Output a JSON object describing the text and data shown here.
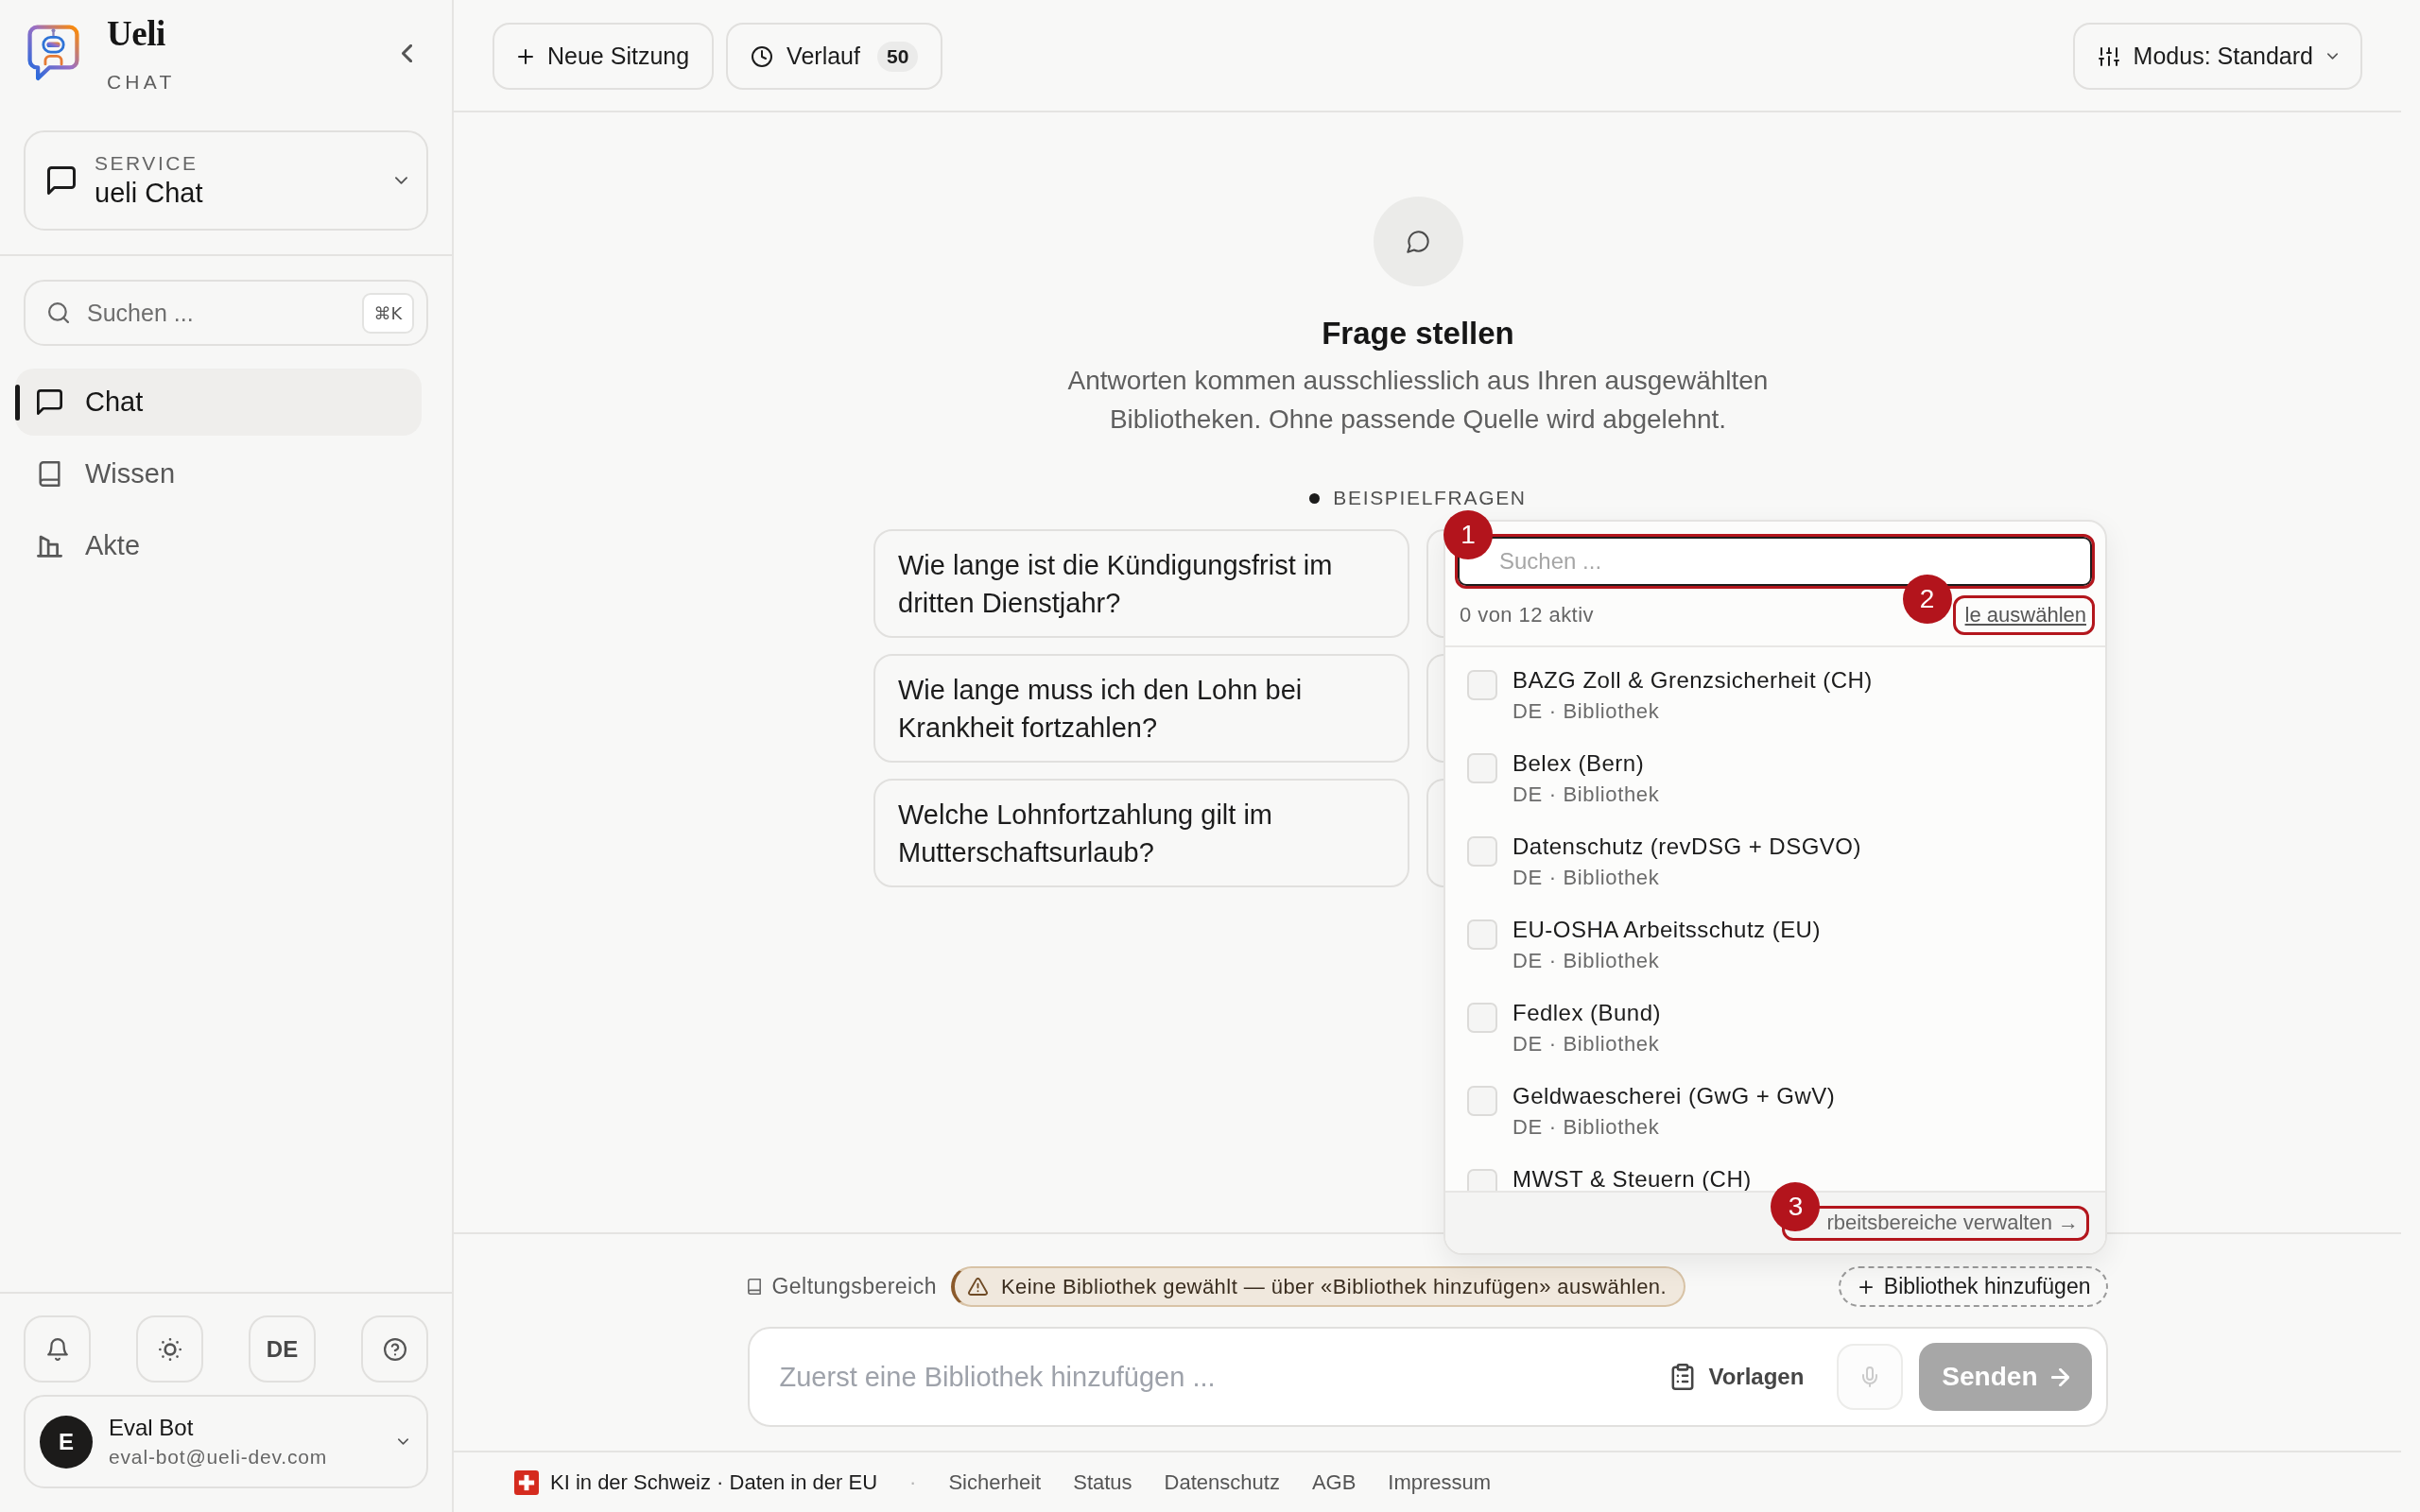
{
  "sidebar": {
    "brand": {
      "name": "Ueli",
      "tagline": "CHAT"
    },
    "service": {
      "label": "SERVICE",
      "value": "ueli Chat"
    },
    "search": {
      "placeholder": "Suchen ...",
      "shortcut": "⌘K"
    },
    "nav": [
      {
        "label": "Chat",
        "selected": true
      },
      {
        "label": "Wissen",
        "selected": false
      },
      {
        "label": "Akte",
        "selected": false
      }
    ],
    "language": "DE",
    "user": {
      "initial": "E",
      "name": "Eval Bot",
      "email": "eval-bot@ueli-dev.com"
    }
  },
  "toolbar": {
    "new_session": "Neue Sitzung",
    "history": {
      "label": "Verlauf",
      "count": "50"
    },
    "mode": "Modus: Standard"
  },
  "hero": {
    "title": "Frage stellen",
    "description": "Antworten kommen ausschliesslich aus Ihren ausgewählten Bibliotheken. Ohne passende Quelle wird abgelehnt."
  },
  "examples": {
    "label": "BEISPIELFRAGEN",
    "questions": [
      "Wie lange ist die Kündigungsfrist im dritten Dienstjahr?",
      "Wie lange muss ich den Lohn bei Krankheit fortzahlen?",
      "Welche Lohnfortzahlung gilt im Mutterschaftsurlaub?"
    ]
  },
  "library_picker": {
    "search": {
      "placeholder": "Suchen ...",
      "marker": "1"
    },
    "summary": "0 von 12 aktiv",
    "select_all": {
      "label": "le auswählen",
      "marker": "2"
    },
    "libraries": [
      {
        "name": "BAZG Zoll & Grenzsicherheit (CH)",
        "meta": "DE · Bibliothek",
        "checked": false
      },
      {
        "name": "Belex (Bern)",
        "meta": "DE · Bibliothek",
        "checked": false
      },
      {
        "name": "Datenschutz (revDSG + DSGVO)",
        "meta": "DE · Bibliothek",
        "checked": false
      },
      {
        "name": "EU-OSHA Arbeitsschutz (EU)",
        "meta": "DE · Bibliothek",
        "checked": false
      },
      {
        "name": "Fedlex (Bund)",
        "meta": "DE · Bibliothek",
        "checked": false
      },
      {
        "name": "Geldwaescherei (GwG + GwV)",
        "meta": "DE · Bibliothek",
        "checked": false
      },
      {
        "name": "MWST & Steuern (CH)",
        "checked": false
      }
    ],
    "manage": {
      "label": "rbeitsbereiche verwalten →",
      "marker": "3"
    }
  },
  "scope": {
    "label": "Geltungsbereich",
    "warning": "Keine Bibliothek gewählt — über «Bibliothek hinzufügen» auswählen.",
    "add": "Bibliothek hinzufügen"
  },
  "composer": {
    "placeholder": "Zuerst eine Bibliothek hinzufügen ...",
    "templates": "Vorlagen",
    "mic": {
      "disabled": true
    },
    "send": {
      "label": "Senden",
      "disabled": true
    }
  },
  "footer": {
    "note": "KI in der Schweiz · Daten in der EU",
    "separator": "·",
    "links": [
      "Sicherheit",
      "Status",
      "Datenschutz",
      "AGB",
      "Impressum"
    ]
  }
}
